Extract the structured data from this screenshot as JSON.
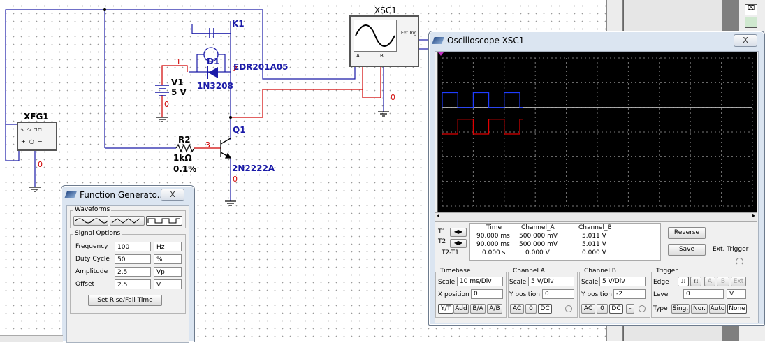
{
  "schematic": {
    "xfg_label": "XFG1",
    "xsc_label": "XSC1",
    "xsc_ext_trig": "Ext Trig",
    "xsc_ch_a": "A",
    "xsc_ch_b": "B",
    "relay_ref": "K1",
    "relay_part": "EDR201A05",
    "diode_ref": "D1",
    "diode_part": "1N3208",
    "battery_ref": "V1",
    "battery_value": "5 V",
    "resistor_ref": "R2",
    "resistor_value": "1kΩ",
    "resistor_tol": "0.1%",
    "transistor_ref": "Q1",
    "transistor_part": "2N2222A",
    "nets": {
      "n1": "1",
      "n2": "2",
      "n3": "3",
      "n0_battery": "0",
      "n0_xfg": "0",
      "n0_scope": "0",
      "n0_q1": "0"
    }
  },
  "function_generator": {
    "title": "Function Generato...",
    "close_label": "X",
    "waveforms_label": "Waveforms",
    "waveform_selected": "square",
    "signal_options_label": "Signal Options",
    "rows": [
      {
        "label": "Frequency",
        "value": "100",
        "unit": "Hz"
      },
      {
        "label": "Duty Cycle",
        "value": "50",
        "unit": "%"
      },
      {
        "label": "Amplitude",
        "value": "2.5",
        "unit": "Vp"
      },
      {
        "label": "Offset",
        "value": "2.5",
        "unit": "V"
      }
    ],
    "rise_fall_button": "Set Rise/Fall Time"
  },
  "oscilloscope": {
    "title": "Oscilloscope-XSC1",
    "close_label": "X",
    "readout": {
      "headers": [
        "Time",
        "Channel_A",
        "Channel_B"
      ],
      "rows": [
        {
          "label": "T1",
          "time": "90.000 ms",
          "a": "500.000 mV",
          "b": "5.011 V"
        },
        {
          "label": "T2",
          "time": "90.000 ms",
          "a": "500.000 mV",
          "b": "5.011 V"
        },
        {
          "label": "T2-T1",
          "time": "0.000 s",
          "a": "0.000 V",
          "b": "0.000 V"
        }
      ]
    },
    "reverse_button": "Reverse",
    "save_button": "Save",
    "ext_trigger_label": "Ext. Trigger",
    "timebase": {
      "label": "Timebase",
      "scale_label": "Scale",
      "scale": "10 ms/Div",
      "xpos_label": "X position",
      "xpos": "0",
      "buttons": [
        "Y/T",
        "Add",
        "B/A",
        "A/B"
      ]
    },
    "channel_a": {
      "label": "Channel A",
      "scale_label": "Scale",
      "scale": "5 V/Div",
      "ypos_label": "Y position",
      "ypos": "0",
      "buttons": [
        "AC",
        "0",
        "DC"
      ]
    },
    "channel_b": {
      "label": "Channel B",
      "scale_label": "Scale",
      "scale": "5 V/Div",
      "ypos_label": "Y position",
      "ypos": "-2",
      "buttons": [
        "AC",
        "0",
        "DC",
        "-"
      ]
    },
    "trigger": {
      "label": "Trigger",
      "edge_label": "Edge",
      "edge_buttons": [
        "A",
        "B",
        "Ext"
      ],
      "level_label": "Level",
      "level": "0",
      "level_unit": "V",
      "type_label": "Type",
      "type_buttons": [
        "Sing.",
        "Nor.",
        "Auto",
        "None"
      ]
    },
    "traces": {
      "channel_a_color": "#1e3cff",
      "channel_b_color": "#e00000"
    }
  },
  "colors": {
    "wire_blue": "#1a1aa8",
    "wire_red": "#d00000",
    "net_label_red": "#d00000"
  }
}
